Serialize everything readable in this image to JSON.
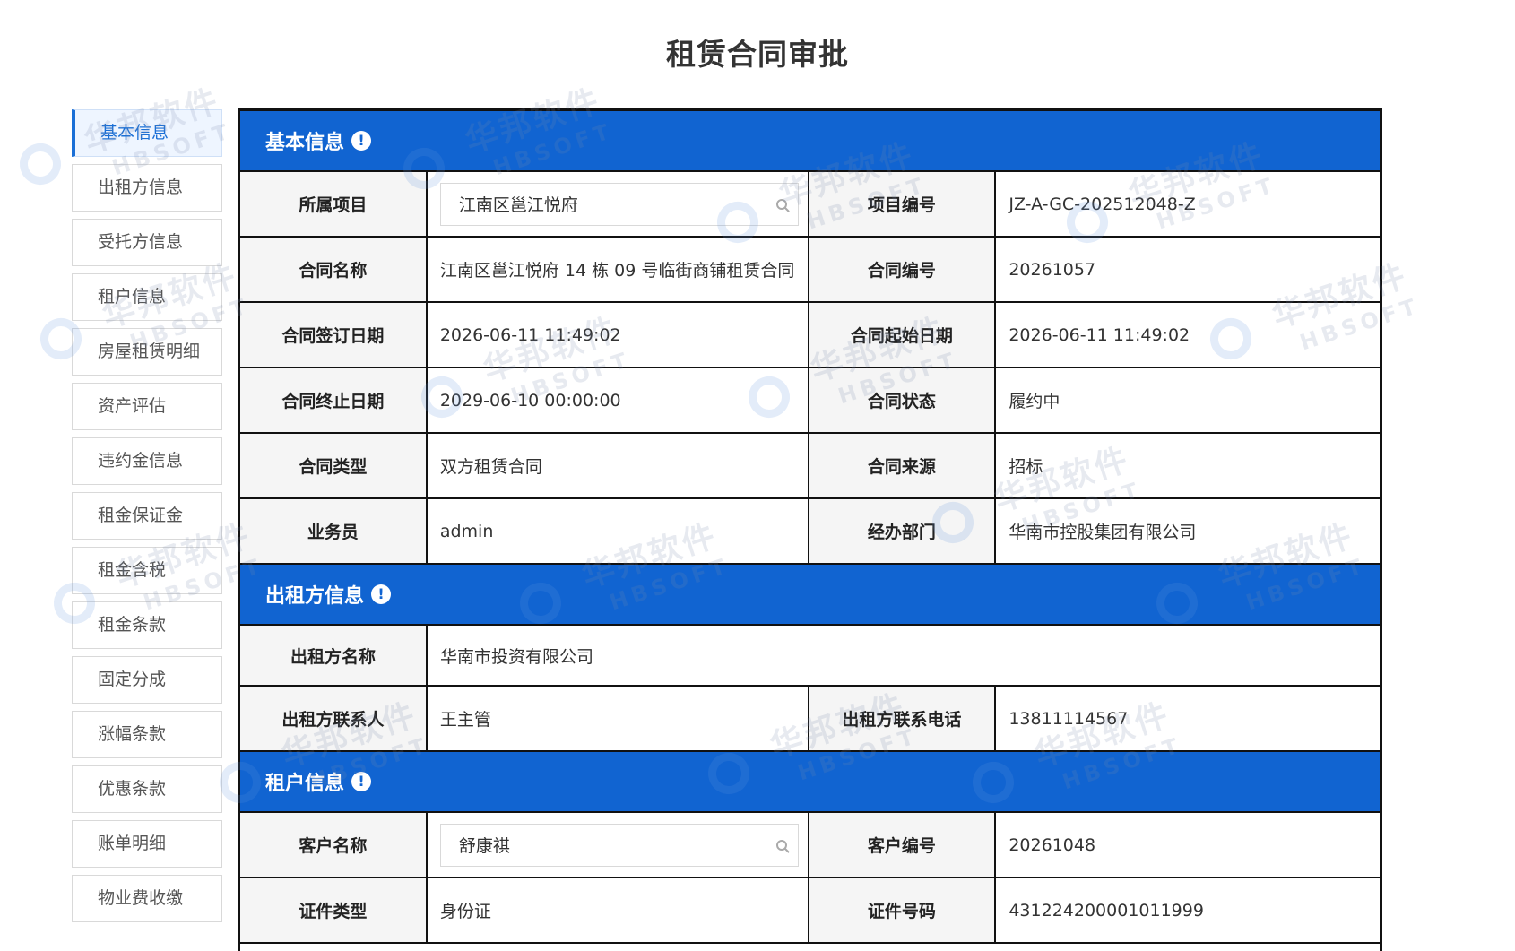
{
  "page_title": "租赁合同审批",
  "sidebar": {
    "items": [
      {
        "label": "基本信息",
        "active": true
      },
      {
        "label": "出租方信息"
      },
      {
        "label": "受托方信息"
      },
      {
        "label": "租户信息"
      },
      {
        "label": "房屋租赁明细"
      },
      {
        "label": "资产评估"
      },
      {
        "label": "违约金信息"
      },
      {
        "label": "租金保证金"
      },
      {
        "label": "租金含税"
      },
      {
        "label": "租金条款"
      },
      {
        "label": "固定分成"
      },
      {
        "label": "涨幅条款"
      },
      {
        "label": "优惠条款"
      },
      {
        "label": "账单明细"
      },
      {
        "label": "物业费收缴"
      }
    ]
  },
  "basic": {
    "title": "基本信息",
    "project_label": "所属项目",
    "project_value": "江南区邕江悦府",
    "project_no_label": "项目编号",
    "project_no_value": "JZ-A-GC-202512048-Z",
    "contract_name_label": "合同名称",
    "contract_name_value": "江南区邕江悦府 14 栋 09 号临街商铺租赁合同",
    "contract_no_label": "合同编号",
    "contract_no_value": "20261057",
    "sign_date_label": "合同签订日期",
    "sign_date_value": "2026-06-11 11:49:02",
    "start_date_label": "合同起始日期",
    "start_date_value": "2026-06-11 11:49:02",
    "end_date_label": "合同终止日期",
    "end_date_value": "2029-06-10 00:00:00",
    "status_label": "合同状态",
    "status_value": "履约中",
    "type_label": "合同类型",
    "type_value": "双方租赁合同",
    "source_label": "合同来源",
    "source_value": "招标",
    "salesman_label": "业务员",
    "salesman_value": "admin",
    "dept_label": "经办部门",
    "dept_value": "华南市控股集团有限公司"
  },
  "lessor": {
    "title": "出租方信息",
    "name_label": "出租方名称",
    "name_value": "华南市投资有限公司",
    "contact_label": "出租方联系人",
    "contact_value": "王主管",
    "phone_label": "出租方联系电话",
    "phone_value": "13811114567"
  },
  "tenant": {
    "title": "租户信息",
    "name_label": "客户名称",
    "name_value": "舒康祺",
    "no_label": "客户编号",
    "no_value": "20261048",
    "id_type_label": "证件类型",
    "id_type_value": "身份证",
    "id_no_label": "证件号码",
    "id_no_value": "431224200001011999"
  },
  "watermark": {
    "cn": "华邦软件",
    "en": "HBSOFT"
  },
  "colors": {
    "header_blue": "#1164d1",
    "active_blue": "#1a6fd6"
  }
}
